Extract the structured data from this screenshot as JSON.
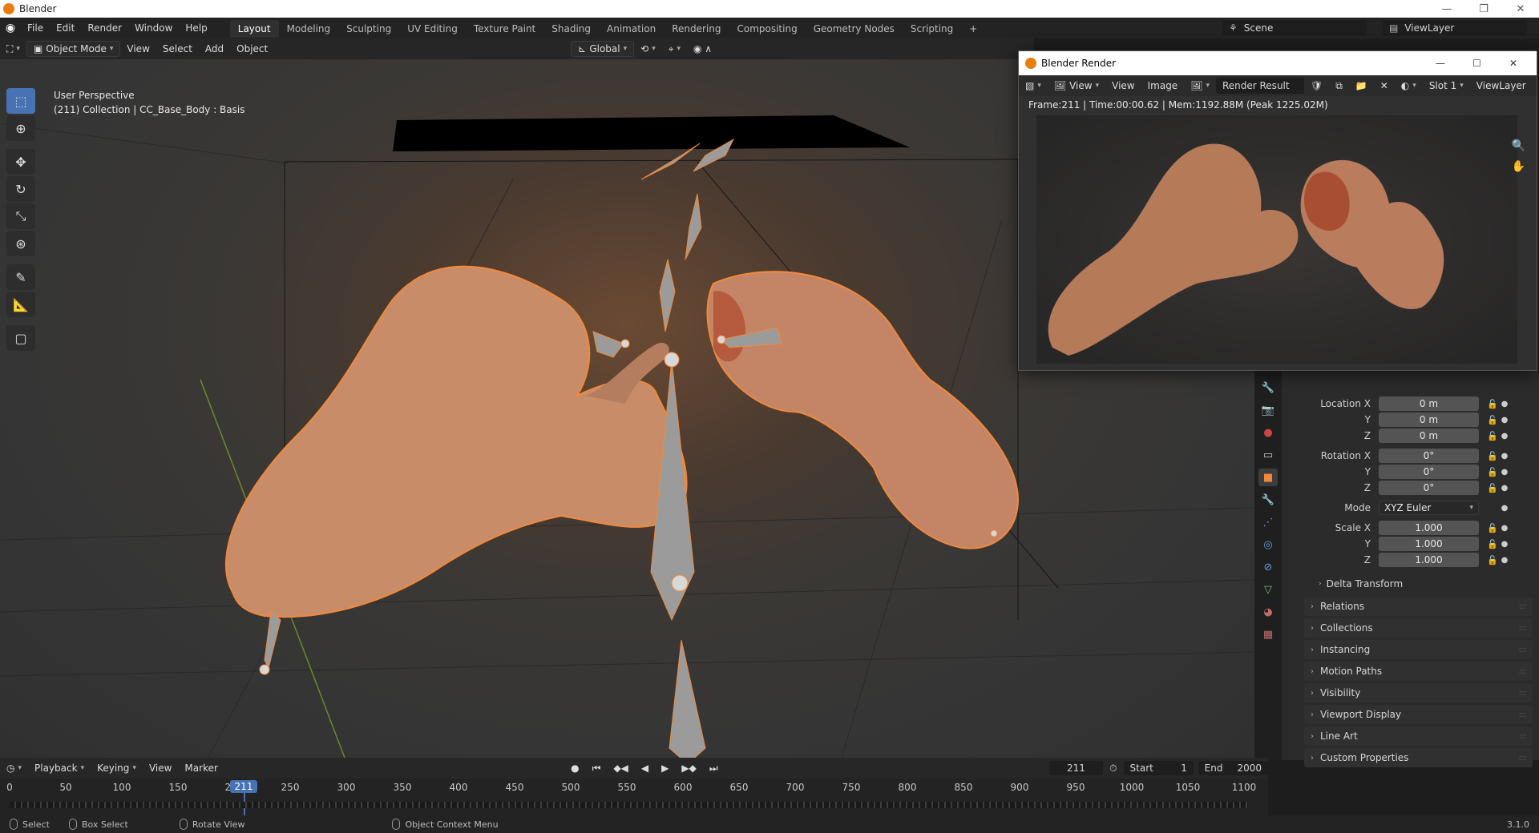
{
  "os_window": {
    "title": "Blender"
  },
  "topbar": {
    "menus": [
      "File",
      "Edit",
      "Render",
      "Window",
      "Help"
    ],
    "workspaces": [
      "Layout",
      "Modeling",
      "Sculpting",
      "UV Editing",
      "Texture Paint",
      "Shading",
      "Animation",
      "Rendering",
      "Compositing",
      "Geometry Nodes",
      "Scripting"
    ],
    "active_workspace": "Layout",
    "scene": "Scene",
    "view_layer": "ViewLayer"
  },
  "viewport_header": {
    "mode": "Object Mode",
    "menus": [
      "View",
      "Select",
      "Add",
      "Object"
    ],
    "transform_orientation": "Global"
  },
  "viewport": {
    "perspective_label": "User Perspective",
    "collection_label": "(211) Collection | CC_Base_Body : Basis"
  },
  "render_window": {
    "title": "Blender Render",
    "menus": [
      "View",
      "View",
      "Image"
    ],
    "image_name": "Render Result",
    "slot": "Slot 1",
    "view_layer": "ViewLayer",
    "stats": "Frame:211 | Time:00:00.62 | Mem:1192.88M (Peak 1225.02M)"
  },
  "properties": {
    "location": {
      "label": "Location X",
      "x": "0 m",
      "y": "0 m",
      "z": "0 m"
    },
    "rotation": {
      "label": "Rotation X",
      "x": "0°",
      "y": "0°",
      "z": "0°"
    },
    "mode_label": "Mode",
    "mode_value": "XYZ Euler",
    "scale": {
      "label": "Scale X",
      "x": "1.000",
      "y": "1.000",
      "z": "1.000"
    },
    "axis_y": "Y",
    "axis_z": "Z",
    "delta_transform": "Delta Transform",
    "sections": [
      "Relations",
      "Collections",
      "Instancing",
      "Motion Paths",
      "Visibility",
      "Viewport Display",
      "Line Art",
      "Custom Properties"
    ]
  },
  "timeline": {
    "menus": [
      "Playback",
      "Keying",
      "View",
      "Marker"
    ],
    "current_frame": "211",
    "start_label": "Start",
    "start": "1",
    "end_label": "End",
    "end": "2000",
    "ticks": [
      "0",
      "50",
      "100",
      "150",
      "200",
      "250",
      "300",
      "350",
      "400",
      "450",
      "500",
      "550",
      "600",
      "650",
      "700",
      "750",
      "800",
      "850",
      "900",
      "950",
      "1000",
      "1050",
      "1100"
    ]
  },
  "statusbar": {
    "items": [
      "Select",
      "Box Select",
      "Rotate View",
      "Object Context Menu"
    ],
    "version": "3.1.0"
  },
  "colors": {
    "accent": "#4772b3",
    "selection_outline": "#f08a3a",
    "blender_orange": "#e87d0d"
  }
}
